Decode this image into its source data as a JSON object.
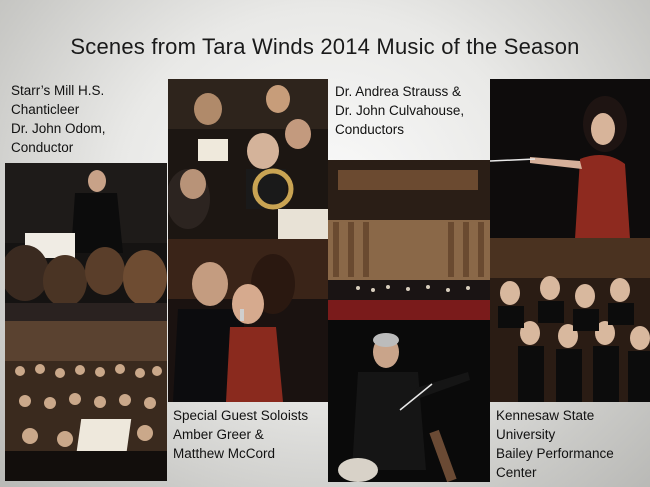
{
  "slide": {
    "title": "Scenes from Tara Winds 2014 Music of the Season"
  },
  "captions": {
    "starrs_mill": [
      "Starr’s Mill H.S.",
      "Chanticleer",
      "Dr. John Odom,",
      "Conductor"
    ],
    "conductors": [
      "Dr. Andrea Strauss  &",
      "Dr. John Culvahouse,",
      "Conductors"
    ],
    "soloists": [
      "Special Guest Soloists",
      "Amber Greer &",
      "Matthew McCord"
    ],
    "venue": [
      "Kennesaw State",
      "University",
      "Bailey Performance",
      "Center"
    ]
  }
}
